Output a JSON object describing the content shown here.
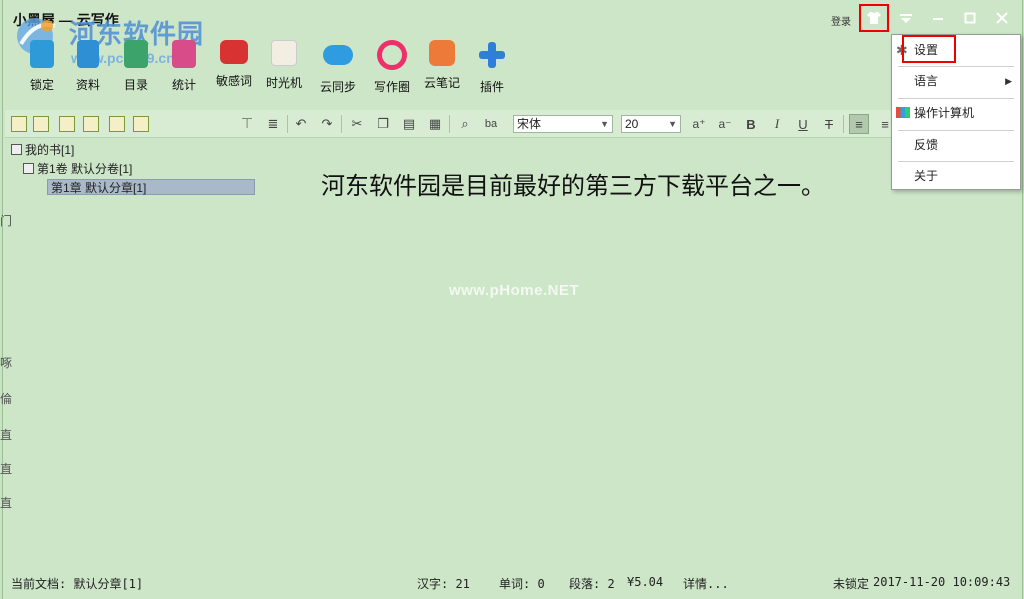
{
  "window": {
    "title": "小黑屋 — 云写作",
    "login_label": "登录"
  },
  "watermark": {
    "brand": "河东软件园",
    "sub": "www.pc0359.cn",
    "center": "www.pHome.NET"
  },
  "toolbar": {
    "items": [
      {
        "label": "锁定",
        "icon": "lock-icon",
        "color": "#2e9bd8"
      },
      {
        "label": "资料",
        "icon": "profile-icon",
        "color": "#2f8fd4"
      },
      {
        "label": "目录",
        "icon": "catalog-icon",
        "color": "#3ca46b"
      },
      {
        "label": "统计",
        "icon": "stats-icon",
        "color": "#d94c8a"
      },
      {
        "label": "敏感词",
        "icon": "sensitive-words-icon",
        "color": "#d93232"
      },
      {
        "label": "时光机",
        "icon": "time-machine-icon",
        "color": "#e8a52a"
      },
      {
        "label": "云同步",
        "icon": "cloud-sync-icon",
        "color": "#2f9be0"
      },
      {
        "label": "写作圈",
        "icon": "writing-circle-icon",
        "color": "#ee2f6b"
      },
      {
        "label": "云笔记",
        "icon": "cloud-note-icon",
        "color": "#ee7a3a"
      },
      {
        "label": "插件",
        "icon": "plugin-icon",
        "color": "#2f7fd8"
      }
    ]
  },
  "tree": {
    "book": "我的书[1]",
    "volume": "第1卷 默认分卷[1]",
    "chapter": "第1章 默认分章[1]"
  },
  "editor": {
    "font": "宋体",
    "size": "20",
    "content": "河东软件园是目前最好的第三方下载平台之一。"
  },
  "status": {
    "current_doc": "当前文档: 默认分章[1]",
    "hanzi": "汉字: 21",
    "words": "单词: 0",
    "paragraphs": "段落: 2",
    "money": "¥5.04",
    "details": "详情...",
    "lock_state": "未锁定",
    "datetime": "2017-11-20  10:09:43"
  },
  "menu": {
    "items": [
      {
        "label": "设置",
        "icon": "gear-icon"
      },
      {
        "label": "语言",
        "icon": ""
      },
      {
        "label": "操作计算机",
        "icon": "computer-control-icon"
      },
      {
        "label": "反馈",
        "icon": ""
      },
      {
        "label": "关于",
        "icon": ""
      }
    ]
  },
  "edge_chars": [
    "门",
    "啄",
    "倫",
    "直",
    "直",
    "直"
  ]
}
